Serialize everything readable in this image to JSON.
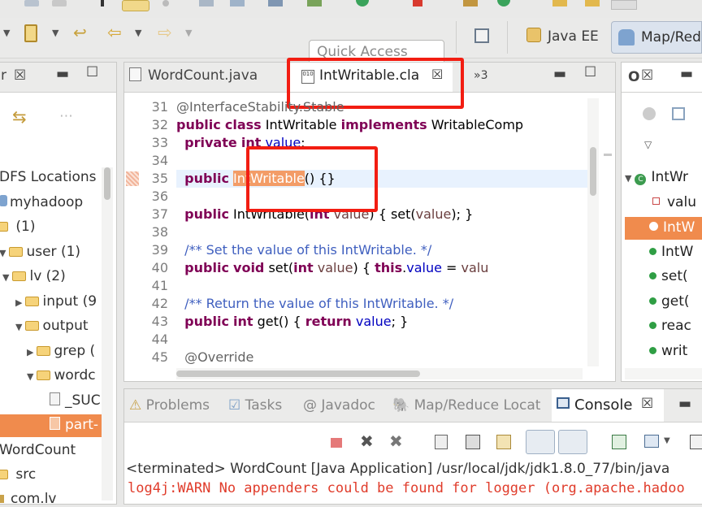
{
  "toolbar": {
    "quick_access_placeholder": "Quick Access",
    "perspectives": [
      "Java EE",
      "Map/Red"
    ]
  },
  "left_panel": {
    "close_glyph": "☒",
    "tree": [
      {
        "label": "DFS Locations",
        "indent": 0,
        "type": "text"
      },
      {
        "label": "myhadoop",
        "indent": 1,
        "type": "elephant"
      },
      {
        "label": "(1)",
        "indent": 0,
        "type": "folder"
      },
      {
        "label": "user (1)",
        "indent": 0,
        "type": "folder-open"
      },
      {
        "label": "lv (2)",
        "indent": 1,
        "type": "folder-open"
      },
      {
        "label": "input (9",
        "indent": 2,
        "type": "folder-closed"
      },
      {
        "label": "output",
        "indent": 2,
        "type": "folder-open"
      },
      {
        "label": "grep (",
        "indent": 3,
        "type": "folder-closed"
      },
      {
        "label": "wordc",
        "indent": 3,
        "type": "folder-open"
      },
      {
        "label": "_SUC",
        "indent": 4,
        "type": "file"
      },
      {
        "label": "part-",
        "indent": 4,
        "type": "file-selected"
      },
      {
        "label": "WordCount",
        "indent": 0,
        "type": "text"
      },
      {
        "label": "src",
        "indent": 0,
        "type": "src"
      },
      {
        "label": "com.lv",
        "indent": 0,
        "type": "pkg"
      }
    ]
  },
  "editor": {
    "tabs": [
      {
        "label": "WordCount.java",
        "active": false
      },
      {
        "label": "IntWritable.cla",
        "active": true,
        "close": "☒"
      },
      {
        "label": "»3",
        "active": false
      }
    ],
    "lines": [
      {
        "n": "31",
        "text": "@InterfaceStability.Stable"
      },
      {
        "n": "32",
        "text": "public class IntWritable implements WritableComp"
      },
      {
        "n": "33",
        "text": "  private int value;"
      },
      {
        "n": "34",
        "text": ""
      },
      {
        "n": "35",
        "text": "  public IntWritable() {}"
      },
      {
        "n": "36",
        "text": ""
      },
      {
        "n": "37",
        "text": "  public IntWritable(int value) { set(value); }"
      },
      {
        "n": "38",
        "text": ""
      },
      {
        "n": "39",
        "text": "  /** Set the value of this IntWritable. */"
      },
      {
        "n": "40",
        "text": "  public void set(int value) { this.value = valu"
      },
      {
        "n": "41",
        "text": ""
      },
      {
        "n": "42",
        "text": "  /** Return the value of this IntWritable. */"
      },
      {
        "n": "43",
        "text": "  public int get() { return value; }"
      },
      {
        "n": "44",
        "text": ""
      },
      {
        "n": "45",
        "text": "  @Override"
      }
    ],
    "selected_token": "IntWritable"
  },
  "outline": {
    "tab_label": "O",
    "close_glyph": "☒",
    "root": "IntWr",
    "items": [
      "valu",
      "IntW",
      "IntW",
      "set(",
      "get(",
      "reac",
      "writ"
    ]
  },
  "bottom": {
    "tabs": [
      "Problems",
      "Tasks",
      "Javadoc",
      "Map/Reduce Locat",
      "Console"
    ],
    "console_close": "☒",
    "terminated_line": "<terminated> WordCount [Java Application] /usr/local/jdk/jdk1.8.0_77/bin/java",
    "log_line": "log4j:WARN No appenders could be found for logger (org.apache.hadoo"
  }
}
